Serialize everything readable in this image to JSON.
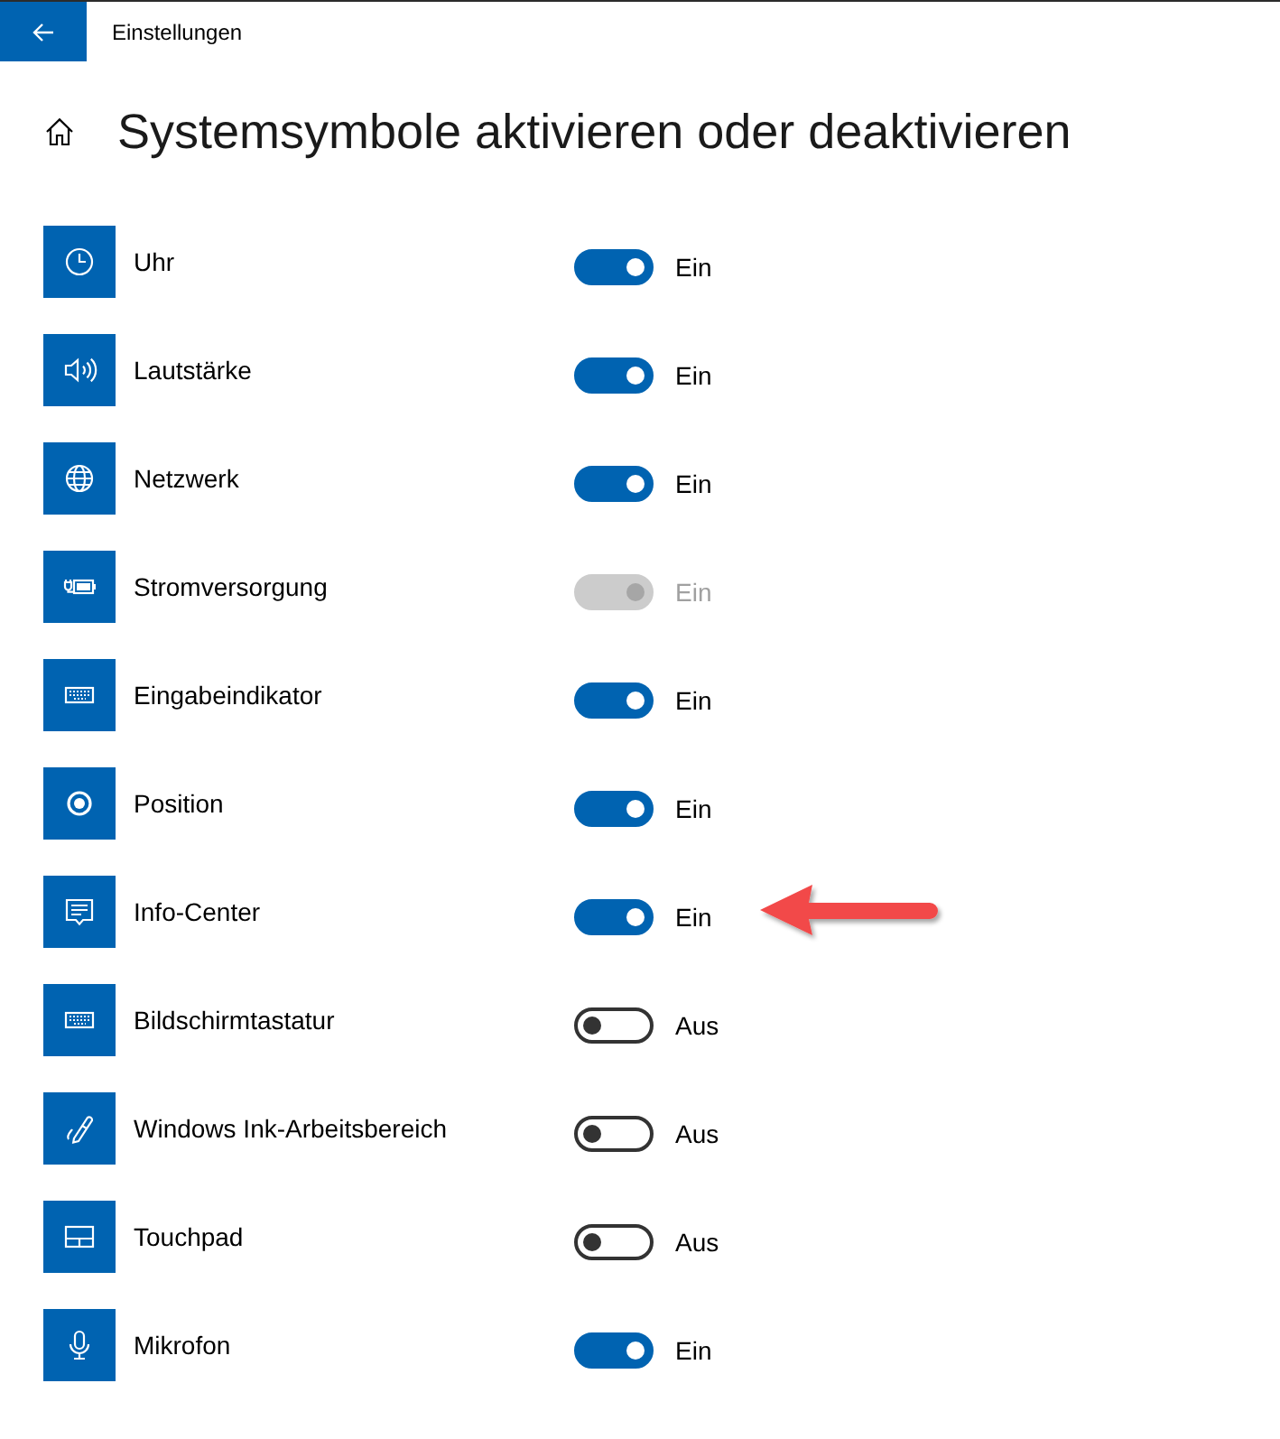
{
  "window": {
    "title": "Einstellungen"
  },
  "page": {
    "title": "Systemsymbole aktivieren oder deaktivieren"
  },
  "items": [
    {
      "label": "Uhr",
      "on": true,
      "disabled": false,
      "state_label": "Ein",
      "marked": false
    },
    {
      "label": "Lautstärke",
      "on": true,
      "disabled": false,
      "state_label": "Ein",
      "marked": false
    },
    {
      "label": "Netzwerk",
      "on": true,
      "disabled": false,
      "state_label": "Ein",
      "marked": false
    },
    {
      "label": "Stromversorgung",
      "on": true,
      "disabled": true,
      "state_label": "Ein",
      "marked": false
    },
    {
      "label": "Eingabeindikator",
      "on": true,
      "disabled": false,
      "state_label": "Ein",
      "marked": false
    },
    {
      "label": "Position",
      "on": true,
      "disabled": false,
      "state_label": "Ein",
      "marked": false
    },
    {
      "label": "Info-Center",
      "on": true,
      "disabled": false,
      "state_label": "Ein",
      "marked": true
    },
    {
      "label": "Bildschirmtastatur",
      "on": false,
      "disabled": false,
      "state_label": "Aus",
      "marked": false
    },
    {
      "label": "Windows Ink-Arbeitsbereich",
      "on": false,
      "disabled": false,
      "state_label": "Aus",
      "marked": false
    },
    {
      "label": "Touchpad",
      "on": false,
      "disabled": false,
      "state_label": "Aus",
      "marked": false
    },
    {
      "label": "Mikrofon",
      "on": true,
      "disabled": false,
      "state_label": "Ein",
      "marked": false
    }
  ]
}
